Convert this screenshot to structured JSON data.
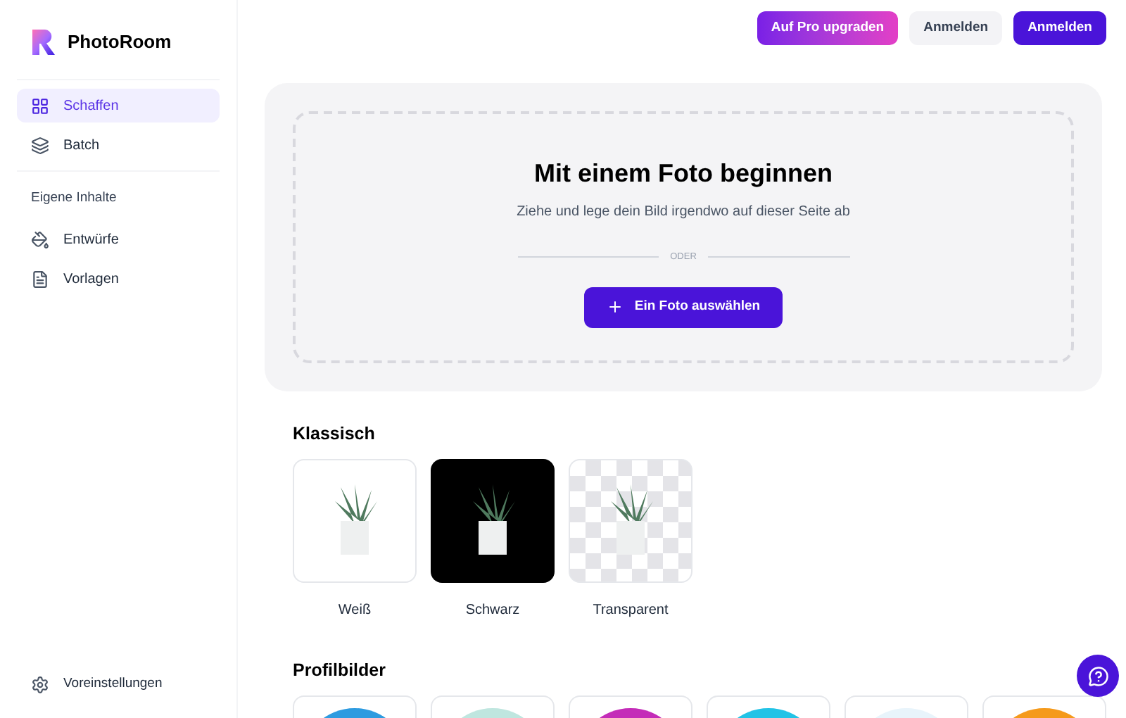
{
  "brand": {
    "name": "PhotoRoom"
  },
  "sidebar": {
    "items": [
      {
        "label": "Schaffen",
        "selected": true
      },
      {
        "label": "Batch",
        "selected": false
      }
    ],
    "section_title": "Eigene Inhalte",
    "own_items": [
      {
        "label": "Entwürfe",
        "selected": false
      },
      {
        "label": "Vorlagen",
        "selected": false
      }
    ],
    "footer_item": {
      "label": "Voreinstellungen"
    }
  },
  "header": {
    "buttons": [
      {
        "label": "Auf Pro upgraden",
        "kind": "gradient"
      },
      {
        "label": "Anmelden",
        "kind": "secondary"
      },
      {
        "label": "Anmelden",
        "kind": "primary"
      }
    ]
  },
  "upload": {
    "title": "Mit einem Foto beginnen",
    "subtitle": "Ziehe und lege dein Bild irgendwo auf dieser Seite ab",
    "divider": "ODER",
    "button": "Ein Foto auswählen"
  },
  "classic": {
    "title": "Klassisch",
    "items": [
      {
        "label": "Weiß",
        "kind": "white"
      },
      {
        "label": "Schwarz",
        "kind": "black"
      },
      {
        "label": "Transparent",
        "kind": "transparent"
      }
    ]
  },
  "profiles": {
    "title": "Profilbilder",
    "items": [
      {
        "color": "#2d9be0"
      },
      {
        "color": "#bfe6df"
      },
      {
        "color": "#c42cb8"
      },
      {
        "color": "#22c3e6"
      },
      {
        "color": "#e8f4fb"
      },
      {
        "color": "#f59a1b"
      }
    ]
  }
}
